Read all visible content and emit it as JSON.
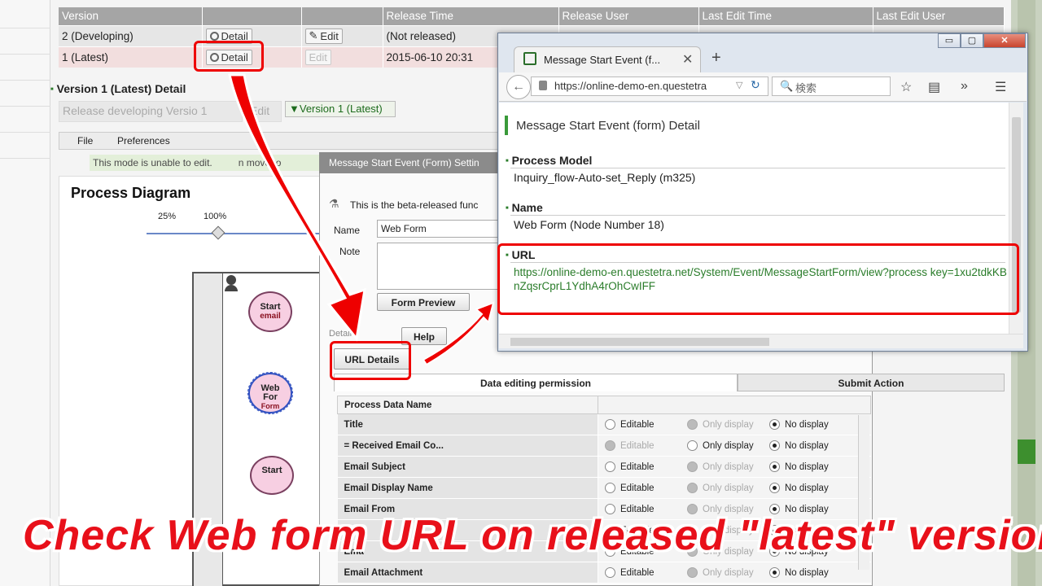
{
  "version_table": {
    "headers": [
      "Version",
      "",
      "",
      "Release Time",
      "Release User",
      "Last Edit Time",
      "Last Edit User"
    ],
    "rows": [
      {
        "version": "2 (Developing)",
        "detail": "Detail",
        "edit": "Edit",
        "release_time": "(Not released)"
      },
      {
        "version": "1 (Latest)",
        "detail": "Detail",
        "edit": "Edit",
        "release_time": "2015-06-10 20:31"
      }
    ]
  },
  "version_detail": {
    "title": "Version 1 (Latest) Detail",
    "release_button": "Release developing Versio",
    "release_num": "1",
    "edit_button": "Edit",
    "version_dropdown": "▼Version 1 (Latest)"
  },
  "menubar": {
    "file": "File",
    "preferences": "Preferences"
  },
  "notice": "This mode is unable to edit.",
  "notice_tail": "n move to",
  "diagram": {
    "title": "Process Diagram",
    "zoom_min": "25%",
    "zoom_cur": "100%",
    "node_start_email_1": "Start",
    "node_start_email_2": "email",
    "node_webform_1": "Web",
    "node_webform_2": "For",
    "node_webform_3": "Form",
    "node_start": "Start"
  },
  "dialog": {
    "title": "Message Start Event (Form) Settin",
    "beta_text": "This is the beta-released func",
    "name_label": "Name",
    "name_value": "Web Form",
    "note_label": "Note",
    "form_preview": "Form Preview",
    "help": "Help",
    "detail_label": "Detail",
    "url_details": "URL Details",
    "tab_permission": "Data editing permission",
    "tab_submit": "Submit Action",
    "table_header": "Process Data Name",
    "options": [
      "Editable",
      "Only display",
      "No display"
    ],
    "rows": [
      {
        "name": "Title",
        "sel": 2,
        "disabled": [
          1
        ]
      },
      {
        "name": "= Received Email Co...",
        "sel": 2,
        "disabled": [
          0
        ]
      },
      {
        "name": "Email Subject",
        "sel": 2,
        "disabled": [
          1
        ]
      },
      {
        "name": "Email Display Name",
        "sel": 2,
        "disabled": [
          1
        ]
      },
      {
        "name": "Email From",
        "sel": 2,
        "disabled": [
          1
        ]
      },
      {
        "name": "Ema",
        "sel": 2,
        "disabled": [
          1
        ]
      },
      {
        "name": "Ema",
        "sel": 2,
        "disabled": [
          1
        ]
      },
      {
        "name": "Email Attachment",
        "sel": 2,
        "disabled": [
          1
        ]
      }
    ]
  },
  "browser": {
    "tab_title": "Message Start Event (f...",
    "url": "https://online-demo-en.questetra",
    "search_placeholder": "検索",
    "page_title": "Message Start Event (form) Detail",
    "sections": {
      "model_label": "Process Model",
      "model_value": "Inquiry_flow-Auto-set_Reply (m325)",
      "name_label": "Name",
      "name_value": "Web Form (Node Number 18)",
      "url_label": "URL",
      "url_value": "https://online-demo-en.questetra.net/System/Event/MessageStartForm/view?process key=1xu2tdkKBnZqsrCprL1YdhA4rOhCwIFF"
    }
  },
  "caption": "Check Web form URL on released \"latest\" version",
  "colors": {
    "accent_red": "#e00000",
    "brand_green": "#2a7c2a"
  }
}
